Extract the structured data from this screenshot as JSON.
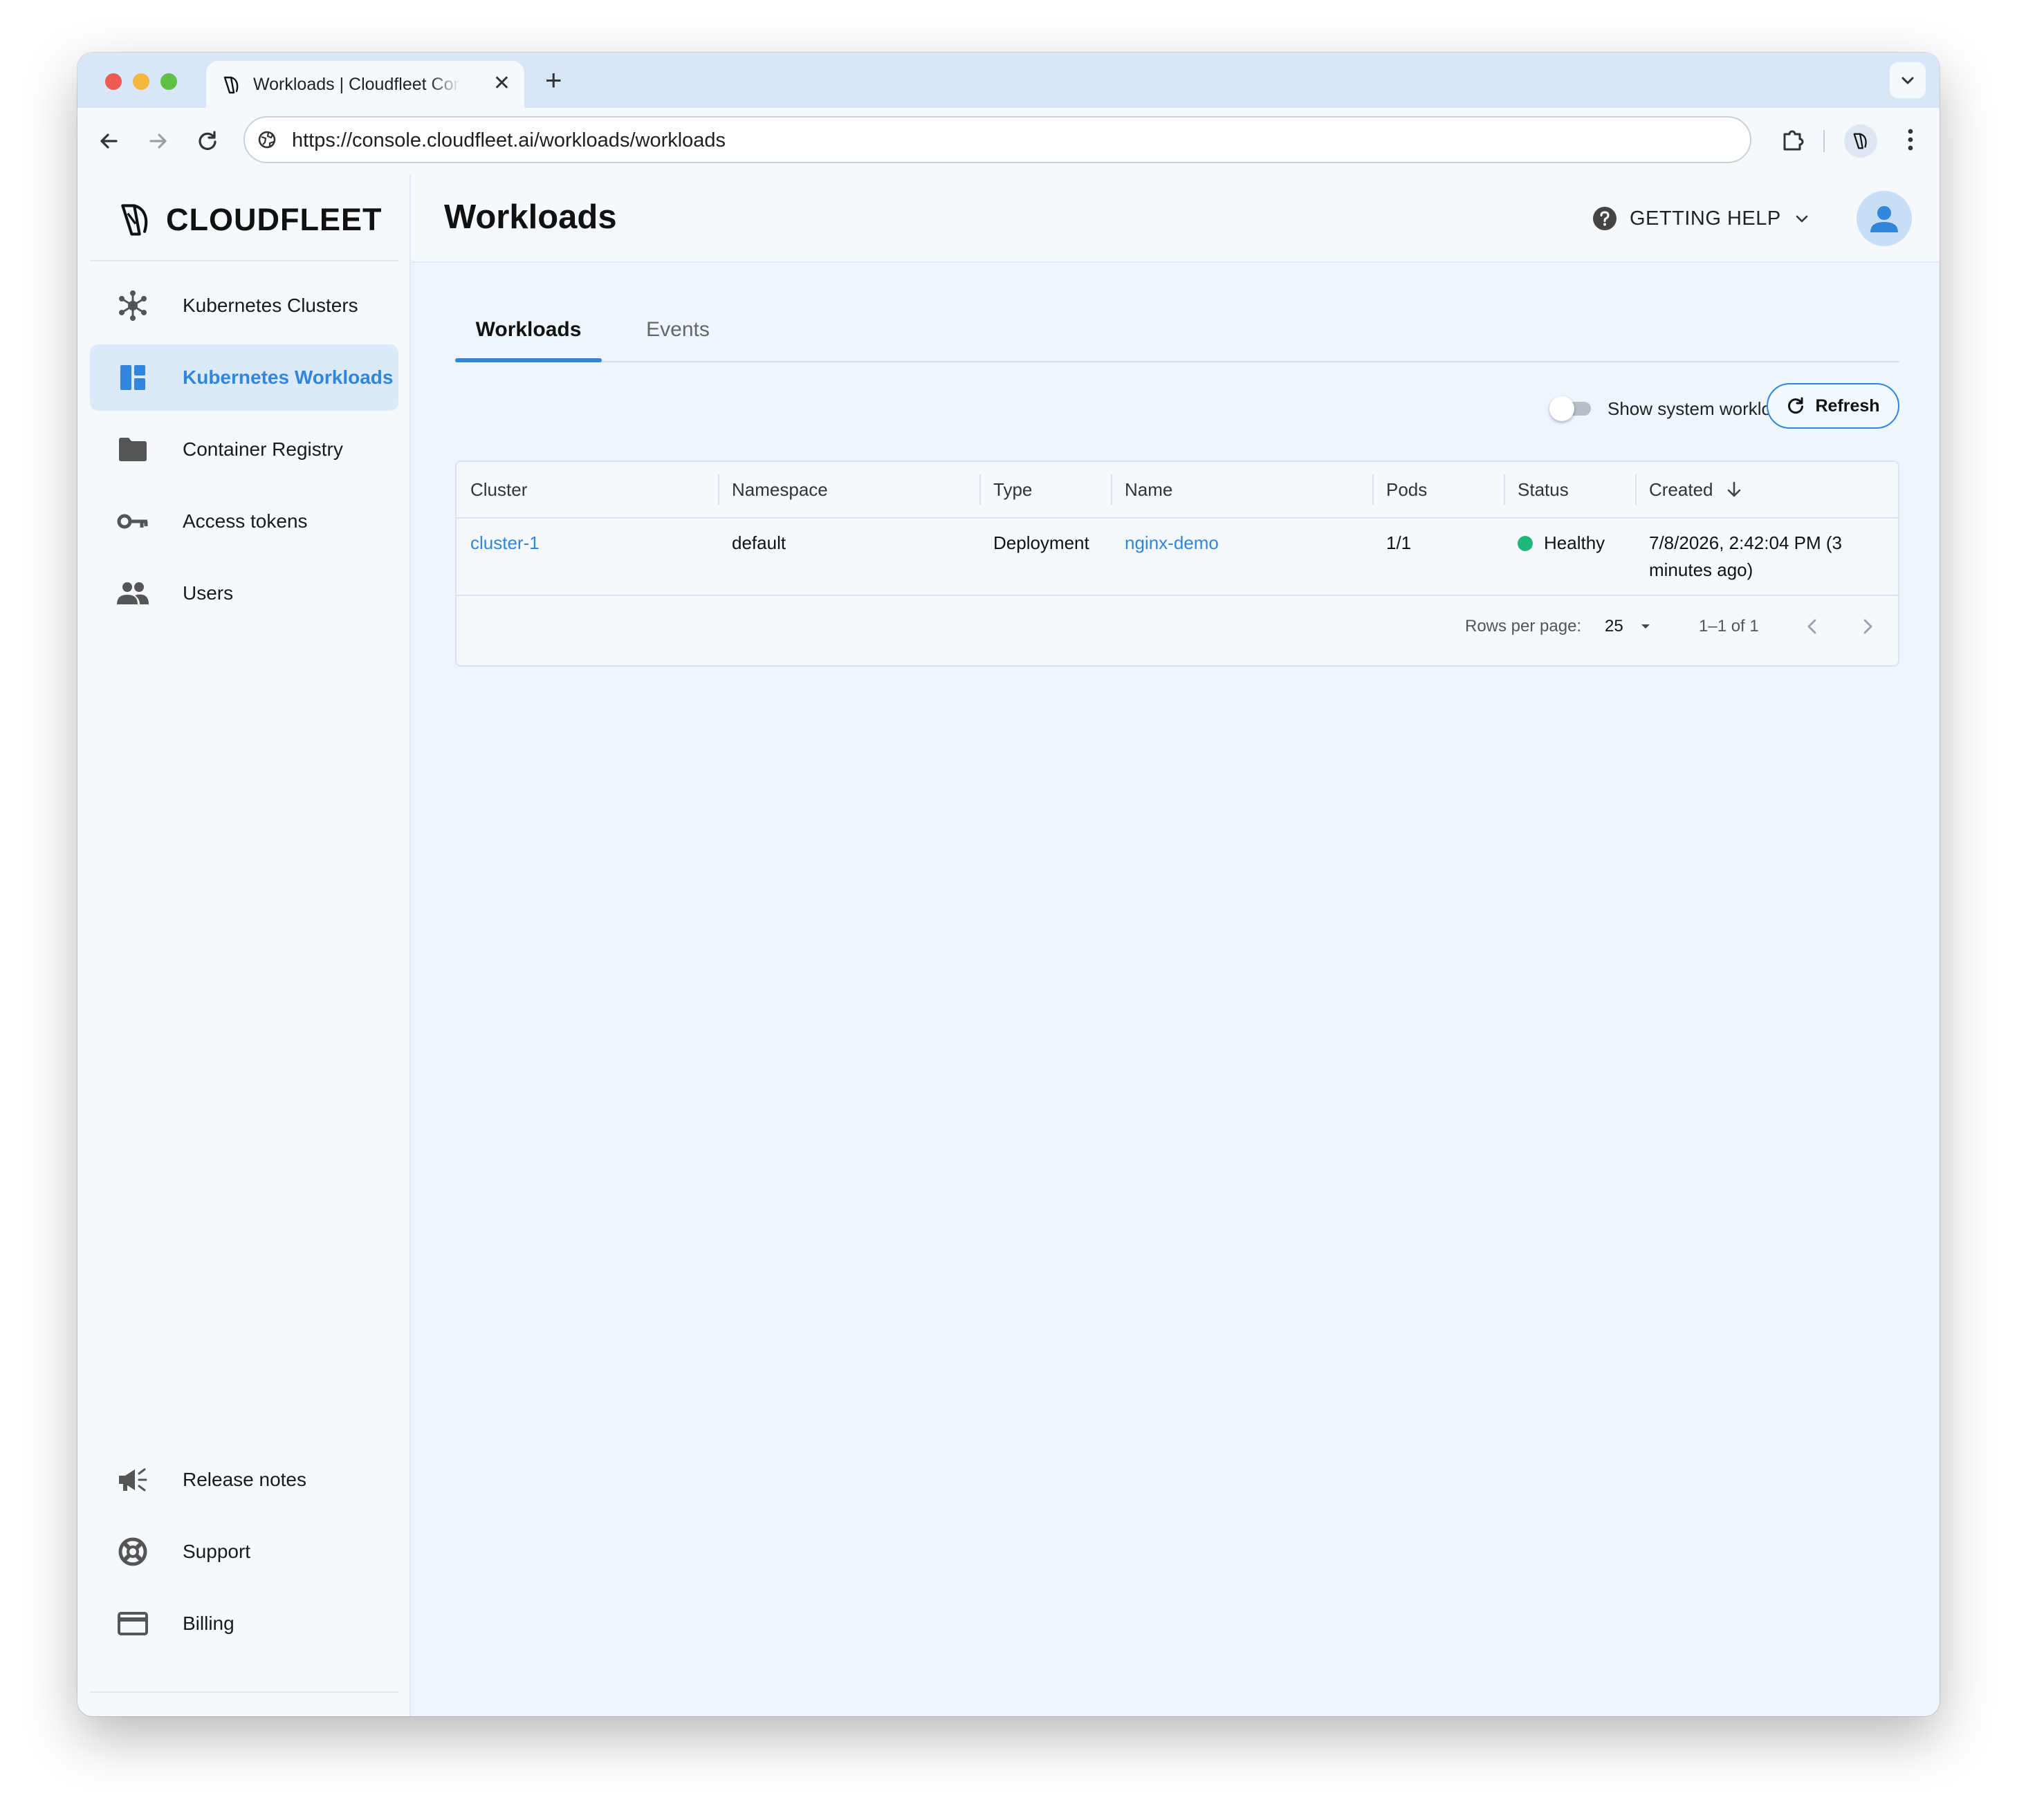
{
  "browser": {
    "tab_title": "Workloads | Cloudfleet Console",
    "url": "https://console.cloudfleet.ai/workloads/workloads"
  },
  "sidebar": {
    "logo_text": "CLOUDFLEET",
    "items": [
      {
        "label": "Kubernetes Clusters",
        "icon": "cluster-icon",
        "active": false
      },
      {
        "label": "Kubernetes Workloads",
        "icon": "dashboard-icon",
        "active": true
      },
      {
        "label": "Container Registry",
        "icon": "folder-icon",
        "active": false
      },
      {
        "label": "Access tokens",
        "icon": "key-icon",
        "active": false
      },
      {
        "label": "Users",
        "icon": "users-icon",
        "active": false
      }
    ],
    "bottom_items": [
      {
        "label": "Release notes",
        "icon": "megaphone-icon"
      },
      {
        "label": "Support",
        "icon": "lifebuoy-icon"
      },
      {
        "label": "Billing",
        "icon": "credit-card-icon"
      }
    ]
  },
  "header": {
    "title": "Workloads",
    "help_label": "GETTING HELP"
  },
  "tabs": [
    {
      "label": "Workloads",
      "active": true
    },
    {
      "label": "Events",
      "active": false
    }
  ],
  "controls": {
    "toggle_label": "Show system workloads",
    "toggle_on": false,
    "refresh_label": "Refresh"
  },
  "table": {
    "columns": [
      "Cluster",
      "Namespace",
      "Type",
      "Name",
      "Pods",
      "Status",
      "Created"
    ],
    "sort_column": "Created",
    "sort_direction": "descending",
    "rows": [
      {
        "cluster": "cluster-1",
        "namespace": "default",
        "type": "Deployment",
        "name": "nginx-demo",
        "pods": "1/1",
        "status": "Healthy",
        "status_color": "#1db87a",
        "created_line1": "7/8/2026, 2:42:04 PM (3",
        "created_line2": "minutes ago)"
      }
    ],
    "pagination": {
      "rows_per_page_label": "Rows per page:",
      "rows_per_page": "25",
      "range": "1–1 of 1"
    }
  },
  "colors": {
    "accent": "#2f86dc",
    "healthy": "#1db87a"
  }
}
